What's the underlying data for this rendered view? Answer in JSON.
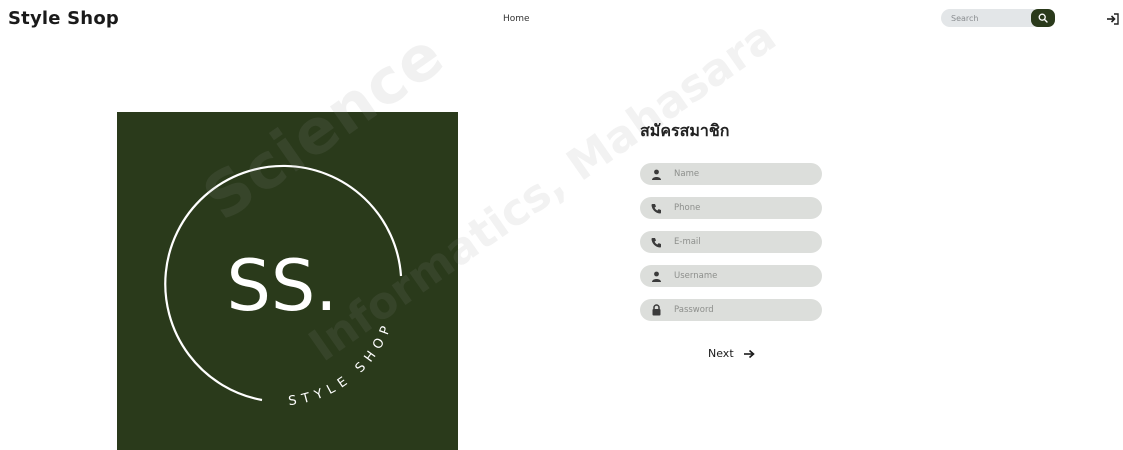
{
  "header": {
    "brand": "Style Shop",
    "nav_home": "Home",
    "search_placeholder": "Search"
  },
  "logo": {
    "monogram": "SS.",
    "ring_text": "STYLE SHOP"
  },
  "watermark": {
    "line1": "Science",
    "line2": "Informatics, Mahasara"
  },
  "form": {
    "title": "สมัครสมาชิก",
    "fields": [
      {
        "placeholder": "Name",
        "icon": "user-icon"
      },
      {
        "placeholder": "Phone",
        "icon": "phone-icon"
      },
      {
        "placeholder": "E-mail",
        "icon": "phone-icon"
      },
      {
        "placeholder": "Username",
        "icon": "user-icon"
      },
      {
        "placeholder": "Password",
        "icon": "lock-icon"
      }
    ],
    "next_label": "Next"
  },
  "colors": {
    "brand_green": "#2a3a1b",
    "field_bg": "#dcdedb"
  }
}
